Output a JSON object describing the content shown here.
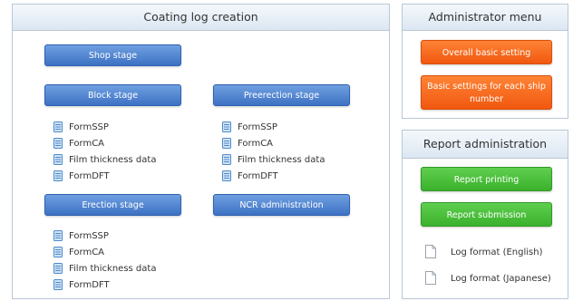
{
  "coating": {
    "title": "Coating log creation",
    "shop_stage": "Shop stage",
    "block_stage": "Block stage",
    "preerection_stage": "Preerection stage",
    "erection_stage": "Erection stage",
    "ncr_administration": "NCR administration",
    "block_forms": [
      "FormSSP",
      "FormCA",
      "Film thickness data",
      "FormDFT"
    ],
    "preerection_forms": [
      "FormSSP",
      "FormCA",
      "Film thickness data",
      "FormDFT"
    ],
    "erection_forms": [
      "FormSSP",
      "FormCA",
      "Film thickness data",
      "FormDFT"
    ]
  },
  "admin": {
    "title": "Administrator menu",
    "overall_basic_setting": "Overall basic setting",
    "basic_settings_line1": "Basic settings for each ship",
    "basic_settings_line2": "number"
  },
  "report": {
    "title": "Report administration",
    "printing": "Report printing",
    "submission": "Report submission",
    "log_format_english": "Log format (English)",
    "log_format_japanese": "Log format (Japanese)"
  },
  "colors": {
    "blue_button": "#4a7fd0",
    "orange_button": "#f76a1f",
    "green_button": "#46bd38",
    "header_bg": "#dce7f2"
  },
  "icons": {
    "form": "form-document-icon",
    "file": "file-icon"
  }
}
